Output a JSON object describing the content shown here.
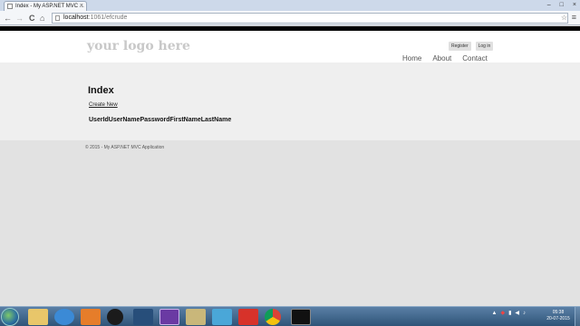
{
  "browser": {
    "tab_title": "Index - My ASP.NET MVC ...",
    "tab_close": "×",
    "window_controls": [
      "–",
      "□",
      "×"
    ],
    "nav": {
      "back": "←",
      "forward": "→",
      "reload": "C",
      "home": "⌂"
    },
    "url_host": "localhost",
    "url_path": ":1061/efcrude",
    "star": "☆",
    "menu": "≡"
  },
  "site": {
    "logo": "your logo here",
    "register": "Register",
    "login": "Log in",
    "menu": [
      "Home",
      "About",
      "Contact"
    ]
  },
  "main": {
    "title": "Index",
    "create_link": "Create New",
    "columns": [
      "UserId",
      "UserName",
      "Password",
      "FirstName",
      "LastName"
    ]
  },
  "footer": {
    "text": "© 2015 - My ASP.NET MVC Application"
  },
  "taskbar": {
    "apps": [
      "explorer",
      "internet-explorer",
      "media-player",
      "hp",
      "mail",
      "visual-studio",
      "tools",
      "ie-alt",
      "red-app",
      "chrome",
      "terminal"
    ],
    "tray_icons": [
      "▲",
      "◆",
      "▮",
      "◀",
      "♪"
    ],
    "clock_time": "05:38",
    "clock_date": "20-07-2015"
  }
}
